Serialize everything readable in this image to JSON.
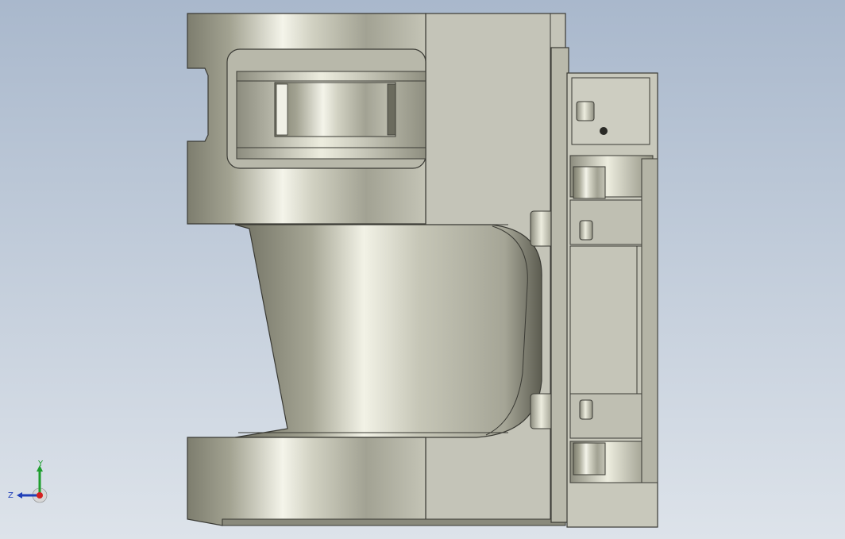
{
  "viewport": {
    "background_top": "#a9b8cc",
    "background_bottom": "#dde3ea",
    "model_body_color": "#c9c9bb",
    "model_edge_color": "#3a3a34"
  },
  "triad": {
    "y_label": "Y",
    "z_label": "Z",
    "y_color": "#1e9e2e",
    "x_color": "#d42020",
    "z_color": "#1f3fb8"
  }
}
